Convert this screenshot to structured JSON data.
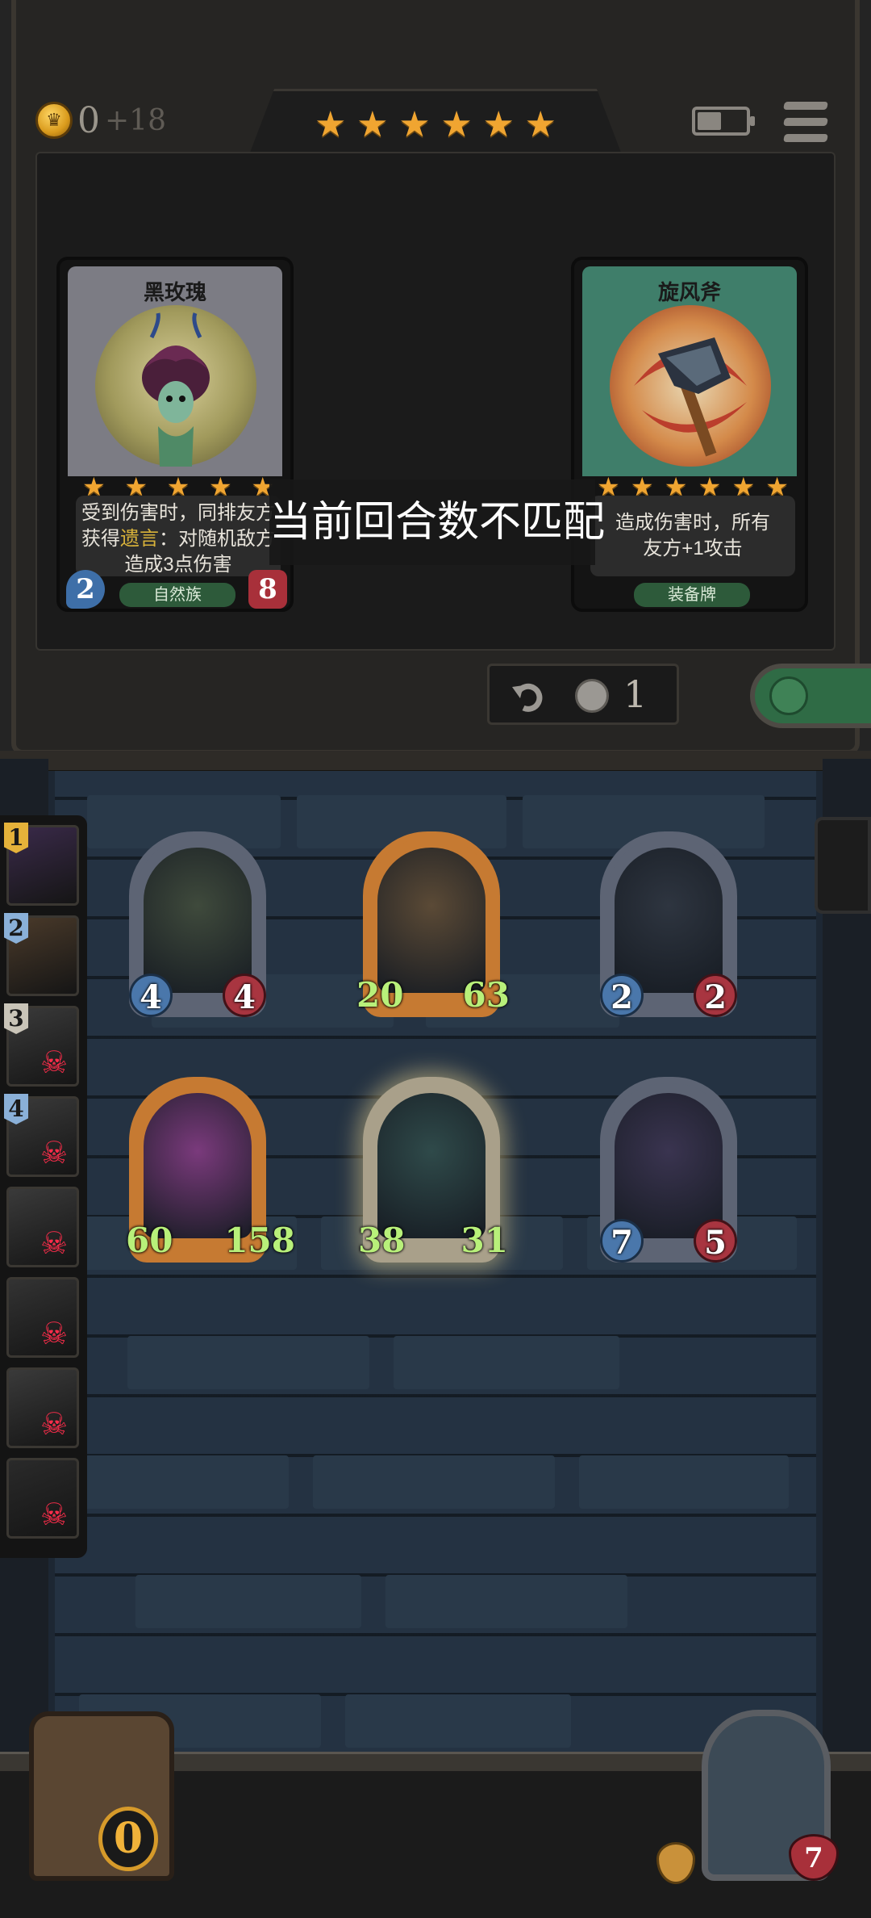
{
  "hud": {
    "gold": "0",
    "gold_income": "+18",
    "tavern_stars": [
      "★",
      "★",
      "★",
      "★",
      "★",
      "★"
    ],
    "battery_level": 0.5,
    "menu_icon": "hamburger-menu-icon"
  },
  "shop": {
    "cards": [
      {
        "name": "黑玫瑰",
        "stars": [
          "★",
          "★",
          "★",
          "★",
          "★"
        ],
        "desc_line1": "受到伤害时，同排友方",
        "desc_line2_pre": "获得",
        "desc_keyword": "遗言",
        "desc_line2_post": "：对随机敌方",
        "desc_line3": "造成3点伤害",
        "tribe": "自然族",
        "attack": "2",
        "health": "8",
        "frame_color": "#7c7c84"
      },
      {
        "name": "旋风斧",
        "stars": [
          "★",
          "★",
          "★",
          "★",
          "★",
          "★"
        ],
        "desc_line1": "造成伤害时，所有",
        "desc_line2": "友方+1攻击",
        "tribe": "装备牌",
        "frame_color": "#3f7e6a"
      }
    ],
    "toast": "当前回合数不匹配",
    "refresh_cost": "1",
    "refresh_icon": "undo-refresh-icon",
    "lock_icon": "lock-icon"
  },
  "board": {
    "minions": [
      {
        "attack": "4",
        "health": "4",
        "buffed": false,
        "frame": "#5d6474",
        "art": "#3f4a3c"
      },
      {
        "attack": "20",
        "health": "63",
        "buffed": true,
        "frame": "#c67a32",
        "art": "#5b4a36"
      },
      {
        "attack": "2",
        "health": "2",
        "buffed": false,
        "frame": "#5d6474",
        "art": "#2e3540"
      },
      {
        "attack": "60",
        "health": "158",
        "buffed": true,
        "frame": "#c67a32",
        "art": "#7a3a7c"
      },
      {
        "attack": "38",
        "health": "31",
        "buffed": true,
        "frame": "#a9a08a",
        "art": "#2f4a4a"
      },
      {
        "attack": "7",
        "health": "5",
        "buffed": false,
        "frame": "#5d6474",
        "art": "#3a3450"
      }
    ]
  },
  "history": [
    {
      "num": "1",
      "num_color": "#e5b23a",
      "eliminated": false,
      "tint": "#3a2a4a"
    },
    {
      "num": "2",
      "num_color": "#8ab0d8",
      "eliminated": false,
      "tint": "#4a3a2a"
    },
    {
      "num": "3",
      "num_color": "#c9c4b8",
      "eliminated": true,
      "tint": "#3a3a3a"
    },
    {
      "num": "4",
      "num_color": "#8ab0d8",
      "eliminated": true,
      "tint": "#3a3a3a"
    },
    {
      "num": "",
      "num_color": "",
      "eliminated": true,
      "tint": "#3a3a3a"
    },
    {
      "num": "",
      "num_color": "",
      "eliminated": true,
      "tint": "#333333"
    },
    {
      "num": "",
      "num_color": "",
      "eliminated": true,
      "tint": "#3a3a3a"
    },
    {
      "num": "",
      "num_color": "",
      "eliminated": true,
      "tint": "#2a2a2a"
    }
  ],
  "bottom": {
    "chest_gold": "0",
    "hero_health": "7"
  }
}
